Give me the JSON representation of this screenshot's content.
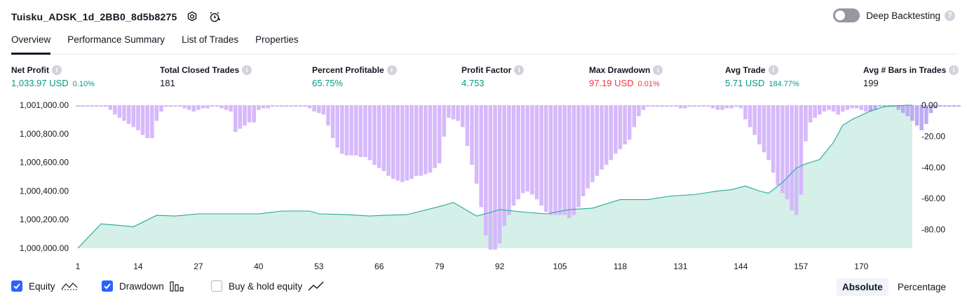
{
  "header": {
    "title": "Tuisku_ADSK_1d_2BB0_8d5b8275",
    "deep_backtesting_label": "Deep Backtesting",
    "deep_backtesting_on": false
  },
  "tabs": [
    "Overview",
    "Performance Summary",
    "List of Trades",
    "Properties"
  ],
  "metrics": [
    {
      "label": "Net Profit",
      "value": "1,033.97 USD",
      "pct": "0.10%",
      "tone": "pos"
    },
    {
      "label": "Total Closed Trades",
      "value": "181",
      "pct": "",
      "tone": "neu"
    },
    {
      "label": "Percent Profitable",
      "value": "65.75%",
      "pct": "",
      "tone": "pos"
    },
    {
      "label": "Profit Factor",
      "value": "4.753",
      "pct": "",
      "tone": "pos"
    },
    {
      "label": "Max Drawdown",
      "value": "97.19 USD",
      "pct": "0.01%",
      "tone": "neg"
    },
    {
      "label": "Avg Trade",
      "value": "5.71 USD",
      "pct": "184.77%",
      "tone": "pos"
    },
    {
      "label": "Avg # Bars in Trades",
      "value": "199",
      "pct": "",
      "tone": "neu"
    }
  ],
  "legend": {
    "equity": "Equity",
    "drawdown": "Drawdown",
    "buy_hold": "Buy & hold equity",
    "equity_checked": true,
    "drawdown_checked": true,
    "buy_hold_checked": false
  },
  "view_toggle": {
    "absolute": "Absolute",
    "percentage": "Percentage",
    "selected": "Absolute"
  },
  "colors": {
    "equity_line": "#22ab94",
    "equity_fill": "#d5efe9",
    "drawdown_bar": "#d4b5fb",
    "drawdown_bar_alt": "#b9a6f2",
    "positive": "#089981",
    "negative": "#f23645",
    "accent": "#2962ff"
  },
  "chart_data": {
    "type": "area",
    "x_tick_labels": [
      "1",
      "14",
      "27",
      "40",
      "53",
      "66",
      "79",
      "92",
      "105",
      "118",
      "131",
      "144",
      "157",
      "170"
    ],
    "y_left_ticks": [
      "1,000,000.00",
      "1,000,200.00",
      "1,000,400.00",
      "1,000,600.00",
      "1,000,800.00",
      "1,001,000.00"
    ],
    "y_right_ticks": [
      "0.00",
      "-20.00",
      "-40.00",
      "-60.00",
      "-80.00"
    ],
    "ylim_left": [
      1000000,
      1001000
    ],
    "ylim_right": [
      -92,
      0
    ],
    "n_trades": 181,
    "series": [
      {
        "name": "Equity",
        "points": [
          [
            1,
            1000000
          ],
          [
            6,
            1000170
          ],
          [
            10,
            1000160
          ],
          [
            13,
            1000150
          ],
          [
            18,
            1000230
          ],
          [
            22,
            1000225
          ],
          [
            27,
            1000240
          ],
          [
            34,
            1000240
          ],
          [
            40,
            1000240
          ],
          [
            45,
            1000260
          ],
          [
            51,
            1000260
          ],
          [
            53,
            1000240
          ],
          [
            59,
            1000235
          ],
          [
            64,
            1000225
          ],
          [
            67,
            1000230
          ],
          [
            72,
            1000235
          ],
          [
            80,
            1000300
          ],
          [
            82,
            1000320
          ],
          [
            87,
            1000225
          ],
          [
            90,
            1000250
          ],
          [
            92,
            1000270
          ],
          [
            98,
            1000250
          ],
          [
            102,
            1000240
          ],
          [
            107,
            1000270
          ],
          [
            112,
            1000280
          ],
          [
            118,
            1000340
          ],
          [
            124,
            1000340
          ],
          [
            129,
            1000365
          ],
          [
            134,
            1000375
          ],
          [
            139,
            1000400
          ],
          [
            142,
            1000410
          ],
          [
            145,
            1000435
          ],
          [
            148,
            1000400
          ],
          [
            150,
            1000385
          ],
          [
            153,
            1000460
          ],
          [
            156,
            1000560
          ],
          [
            158,
            1000590
          ],
          [
            161,
            1000620
          ],
          [
            164,
            1000740
          ],
          [
            166,
            1000860
          ],
          [
            168,
            1000900
          ],
          [
            172,
            1000960
          ],
          [
            175,
            1000990
          ],
          [
            180,
            1001000
          ],
          [
            182,
            1001020
          ]
        ]
      },
      {
        "name": "Drawdown",
        "values": [
          -1,
          -1,
          -1,
          -1,
          -1,
          -1,
          -1,
          -3,
          -6,
          -8,
          -10,
          -12,
          -14,
          -16,
          -19,
          -21,
          -21,
          -10,
          -4,
          -1,
          -1,
          -1,
          -1,
          -2,
          -3,
          -4,
          -3,
          -2,
          -2,
          -1,
          -1,
          -2,
          -3,
          -4,
          -17,
          -15,
          -13,
          -11,
          -11,
          -3,
          -2,
          -2,
          -1,
          -1,
          -1,
          -1,
          -1,
          -1,
          -1,
          -1,
          -2,
          -4,
          -5,
          -6,
          -13,
          -21,
          -27,
          -31,
          -32,
          -32,
          -32,
          -33,
          -33,
          -35,
          -38,
          -40,
          -42,
          -45,
          -47,
          -48,
          -49,
          -48,
          -47,
          -45,
          -45,
          -44,
          -43,
          -40,
          -37,
          -20,
          -8,
          -9,
          -10,
          -14,
          -26,
          -38,
          -50,
          -65,
          -83,
          -92,
          -92,
          -88,
          -77,
          -70,
          -64,
          -60,
          -56,
          -55,
          -57,
          -60,
          -64,
          -68,
          -70,
          -70,
          -70,
          -70,
          -72,
          -70,
          -65,
          -58,
          -53,
          -49,
          -45,
          -41,
          -38,
          -35,
          -31,
          -28,
          -25,
          -22,
          -14,
          -7,
          -3,
          -1,
          -1,
          -1,
          -1,
          -1,
          -1,
          -1,
          -2,
          -2,
          -1,
          -1,
          -1,
          -1,
          -1,
          -2,
          -3,
          -3,
          -2,
          -2,
          -1,
          -2,
          -9,
          -14,
          -19,
          -25,
          -30,
          -35,
          -43,
          -51,
          -56,
          -60,
          -67,
          -70,
          -57,
          -23,
          -11,
          -8,
          -6,
          -4,
          -3,
          -4,
          -6,
          -4,
          -3,
          -2,
          -2,
          -3,
          -4,
          -4,
          -3,
          -1,
          -1,
          -1,
          -1,
          -3,
          -5,
          -7,
          -10,
          -13,
          -16,
          -12,
          -5,
          -2,
          -1,
          -1,
          -1,
          -1,
          -1
        ]
      }
    ],
    "grid": false
  }
}
